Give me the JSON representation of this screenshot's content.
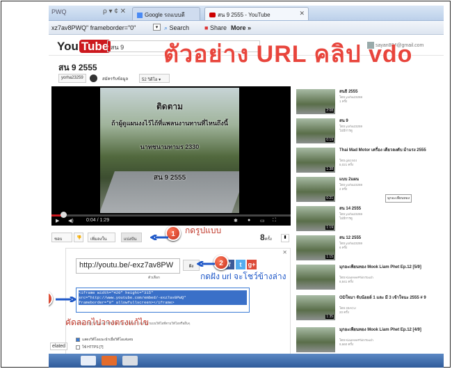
{
  "browser": {
    "address_fragment": "PWQ",
    "address_icons": "ρ ▾ ¢ ✕",
    "tabs": [
      {
        "label": "Google รถแบบดี",
        "icon": "google-favicon"
      },
      {
        "label": "สน 9 2555 - YouTube",
        "icon": "youtube-favicon"
      }
    ],
    "toolbar_fragment": "xz7av8PWQ\" frameborder=\"0\"",
    "toolbar_drop": "▾",
    "toolbar_search": "Search",
    "toolbar_share": "Share",
    "toolbar_more": "More »"
  },
  "youtube": {
    "logo_you": "You",
    "logo_tube": "Tube",
    "search_value": "สน 9",
    "user_email": "sayan884@gmail.com"
  },
  "overlay_title": "ตัวอย่าง URL คลิป vdo",
  "video": {
    "title": "สน 9 2555",
    "channel": "yorha23259",
    "subscribe": "สมัครรับข้อมูล",
    "video_count": "52 วิดีโอ ▾",
    "frame_lines": [
      "ติดตาม",
      "ถ้าผู้ดูแผนงงไว้ไถ้ที่แพลนงานทานที่ไหนถึงนี้",
      "นาทชนามทามร 2330",
      "สน 9 2555"
    ],
    "time": "0:04 / 1:29",
    "progress": 0.04,
    "buttons": {
      "like": "ชอบ",
      "dislike": "👎",
      "add_to": "เพิ่มลงใน",
      "share": "แบ่งปัน"
    },
    "views_number": "8",
    "views_unit": "ครั้ง"
  },
  "share": {
    "short_url": "http://youtu.be/-exz7av8PW",
    "options_label": "ตัวเลือก",
    "share_btn": "ฝัง",
    "social": [
      "f",
      "t",
      "g+"
    ],
    "embed_code": "<iframe width=\"420\" height=\"315\"\nsrc=\"http://www.youtube.com/embed/-exz7av8PWQ\"\nframeborder=\"0\" allowfullscreen></iframe>",
    "small_text": "หลังจากที่ผู้ดูวิดีโอแล้วให้ติดตามเนื้อหาที่ติดตามกับที่ด้านบนวิดีโอที่ตามวิดีโอหรืออื่นๆ",
    "checks": [
      {
        "label": "แสดงวิดีโอแนะนำเมื่อวิดีโอเล่นจบ",
        "checked": true
      },
      {
        "label": "ใช้ HTTPS [?]",
        "checked": false
      }
    ]
  },
  "annotations": {
    "step1": "1",
    "step1_text": "กดรูปแบบ",
    "step2": "2",
    "step2_text": "กดฝัง url จะโชว์ข้างล่าง",
    "step3": "3",
    "step3_text": "คัดลอกไปวางตรงแก้ไข"
  },
  "sidebar": [
    {
      "title": "สนธิ 2555",
      "meta1": "โดย yorha23259",
      "meta2": "1 ครั้ง",
      "duration": "2:08"
    },
    {
      "title": "สน 9",
      "meta1": "โดย yorha23259",
      "meta2": "ไม่มีการดู",
      "duration": "0:19"
    },
    {
      "title": "Thai Mad Motor เครื่อง เดียวลงดับ ม้าแรง 2555",
      "meta1": "โดย ginz444",
      "meta2": "5,021 ครั้ง",
      "duration": "1:38"
    },
    {
      "title": "แบบ 2แผน",
      "meta1": "โดย yorha23259",
      "meta2": "2 ครั้ง",
      "duration": "0:21"
    },
    {
      "title": "สน 14 2555",
      "meta1": "โดย yorha23259",
      "meta2": "ไม่มีการดู",
      "duration": "1:19"
    },
    {
      "title": "สน 12 2555",
      "meta1": "โดย yorha23259",
      "meta2": "6 ครั้ง",
      "duration": "1:15"
    },
    {
      "title": "มุกอะเพียนทอง Mook Liam Phet Ep.12 [5/9]",
      "meta1": "โดย KiaoHeePhimTouch",
      "meta2": "8,841 ครั้ง",
      "duration": ""
    },
    {
      "title": "ODใจมา จับน้อยล์ 1 และ มี 3 เข้าใจนะ 2555 # 9",
      "meta1": "โดย 33ACU",
      "meta2": "20 ครั้ง",
      "duration": "1:35"
    },
    {
      "title": "มุกอะเพียนทอง Mook Liam Phet Ep.12 [4/9]",
      "meta1": "โดย KiaoHeePhimTouch",
      "meta2": "9,660 ครั้ง",
      "duration": ""
    }
  ],
  "tooltip": "มุกอะเพียนทอง",
  "related_label": "elated"
}
